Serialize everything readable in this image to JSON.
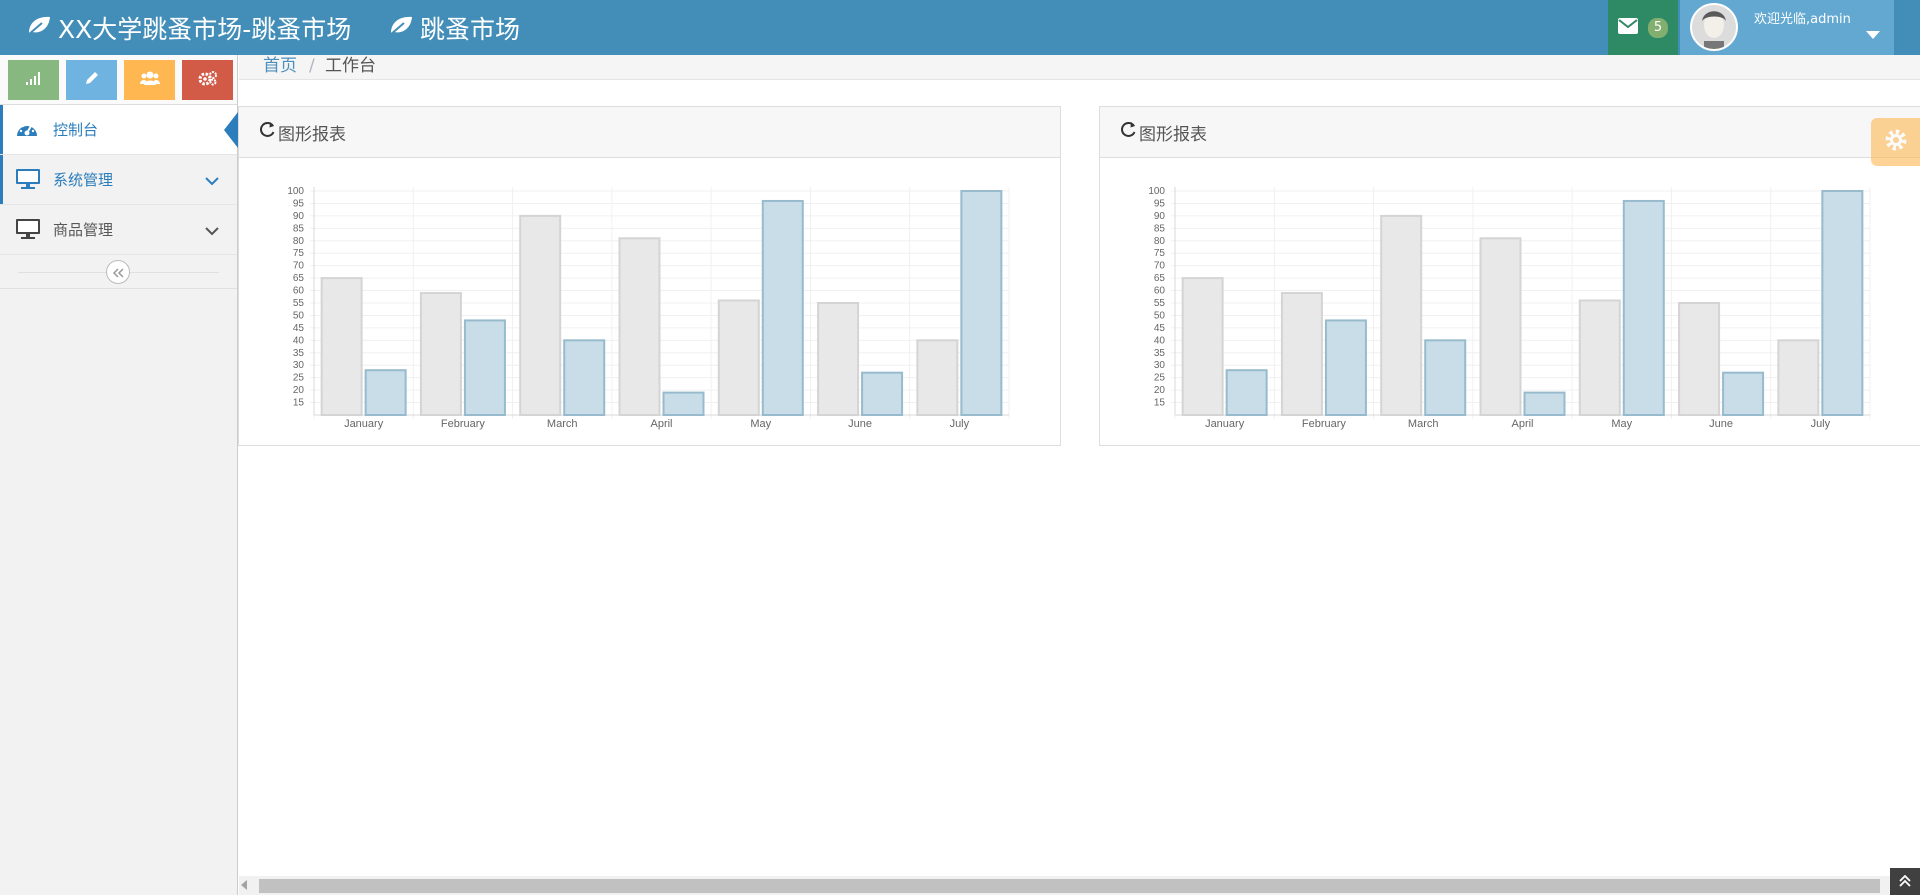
{
  "navbar": {
    "brand_primary": "XX大学跳蚤市场-跳蚤市场",
    "brand_secondary": "跳蚤市场",
    "mail_count": "5",
    "welcome_text": "欢迎光临,admin",
    "icons": [
      "leaf-icon",
      "envelope-icon",
      "caret-down-icon"
    ],
    "bg_color": "#438eb9"
  },
  "sidebar": {
    "shortcuts": [
      {
        "icon": "signal-icon",
        "color": "#87b87f"
      },
      {
        "icon": "pencil-icon",
        "color": "#6fb3e0"
      },
      {
        "icon": "users-icon",
        "color": "#ffb752"
      },
      {
        "icon": "cogs-icon",
        "color": "#d15b47"
      }
    ],
    "items": [
      {
        "label": "控制台",
        "icon": "dashboard-icon",
        "active": true
      },
      {
        "label": "系统管理",
        "icon": "desktop-icon",
        "has_submenu": true
      },
      {
        "label": "商品管理",
        "icon": "desktop-icon",
        "has_submenu": true
      }
    ],
    "collapse_icon": "double-angle-left-icon"
  },
  "breadcrumbs": {
    "home": "首页",
    "separator": "/",
    "current": "工作台"
  },
  "widgets": [
    {
      "title": "图形报表",
      "icon": "refresh-icon"
    },
    {
      "title": "图形报表",
      "icon": "refresh-icon"
    }
  ],
  "chart_data": [
    {
      "type": "bar",
      "categories": [
        "January",
        "February",
        "March",
        "April",
        "May",
        "June",
        "July"
      ],
      "series": [
        {
          "values": [
            65,
            59,
            90,
            81,
            56,
            55,
            40
          ],
          "color": "#e8e8e8"
        },
        {
          "values": [
            28,
            48,
            40,
            19,
            96,
            27,
            100
          ],
          "color": "#c9dde8"
        }
      ],
      "ylim": [
        10,
        100
      ],
      "yticks": [
        15,
        20,
        25,
        30,
        35,
        40,
        45,
        50,
        55,
        60,
        65,
        70,
        75,
        80,
        85,
        90,
        95,
        100
      ],
      "grid": true
    },
    {
      "type": "bar",
      "categories": [
        "January",
        "February",
        "March",
        "April",
        "May",
        "June",
        "July"
      ],
      "series": [
        {
          "values": [
            65,
            59,
            90,
            81,
            56,
            55,
            40
          ],
          "color": "#e8e8e8"
        },
        {
          "values": [
            28,
            48,
            40,
            19,
            96,
            27,
            100
          ],
          "color": "#c9dde8"
        }
      ],
      "ylim": [
        10,
        100
      ],
      "yticks": [
        15,
        20,
        25,
        30,
        35,
        40,
        45,
        50,
        55,
        60,
        65,
        70,
        75,
        80,
        85,
        90,
        95,
        100
      ],
      "grid": true
    }
  ],
  "settings_icon": "gear-icon",
  "back_to_top_icon": "double-angle-up-icon"
}
